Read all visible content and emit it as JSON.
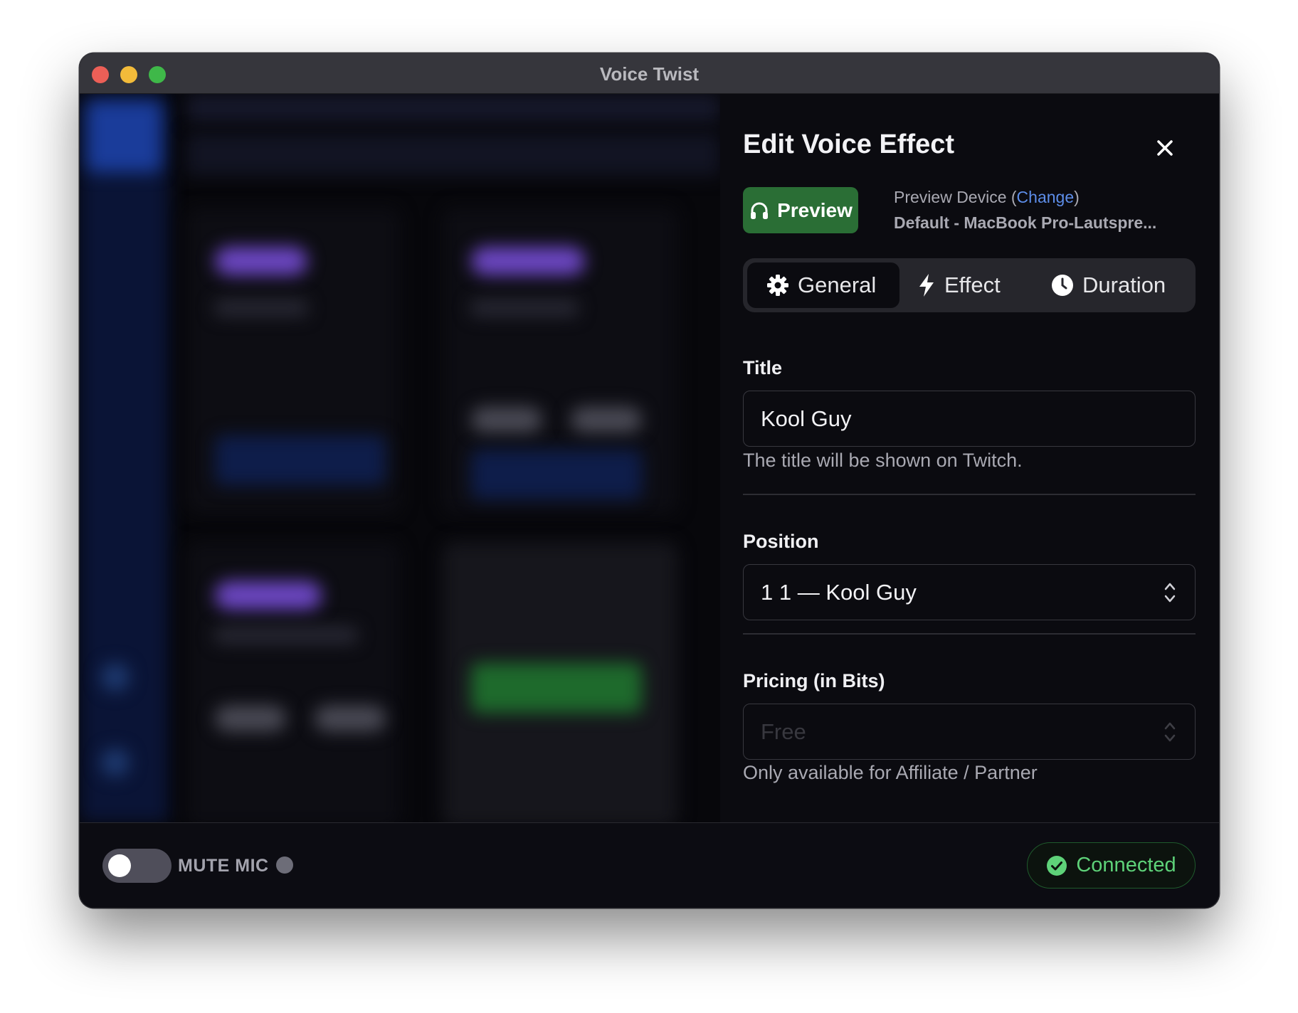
{
  "window": {
    "title": "Voice Twist"
  },
  "panel": {
    "title": "Edit Voice Effect",
    "preview_button": "Preview",
    "preview_device_prefix": "Preview Device (",
    "preview_device_link": "Change",
    "preview_device_suffix": ")",
    "preview_device_name": "Default - MacBook Pro-Lautspre...",
    "tabs": [
      {
        "label": "General",
        "icon": "gear-icon",
        "active": true
      },
      {
        "label": "Effect",
        "icon": "lightning-icon",
        "active": false
      },
      {
        "label": "Duration",
        "icon": "clock-icon",
        "active": false
      }
    ],
    "title_field": {
      "label": "Title",
      "value": "Kool Guy",
      "help": "The title will be shown on Twitch."
    },
    "position_field": {
      "label": "Position",
      "value": "1 1 — Kool Guy"
    },
    "pricing_field": {
      "label": "Pricing (in Bits)",
      "value": "Free",
      "disabled": true,
      "help": "Only available for Affiliate / Partner"
    }
  },
  "footer": {
    "mute_label": "MUTE MIC",
    "mute_on": false,
    "status": "Connected"
  },
  "colors": {
    "accent_green": "#2a6e35",
    "link_blue": "#5d8de8",
    "connected_green": "#5ed279"
  }
}
